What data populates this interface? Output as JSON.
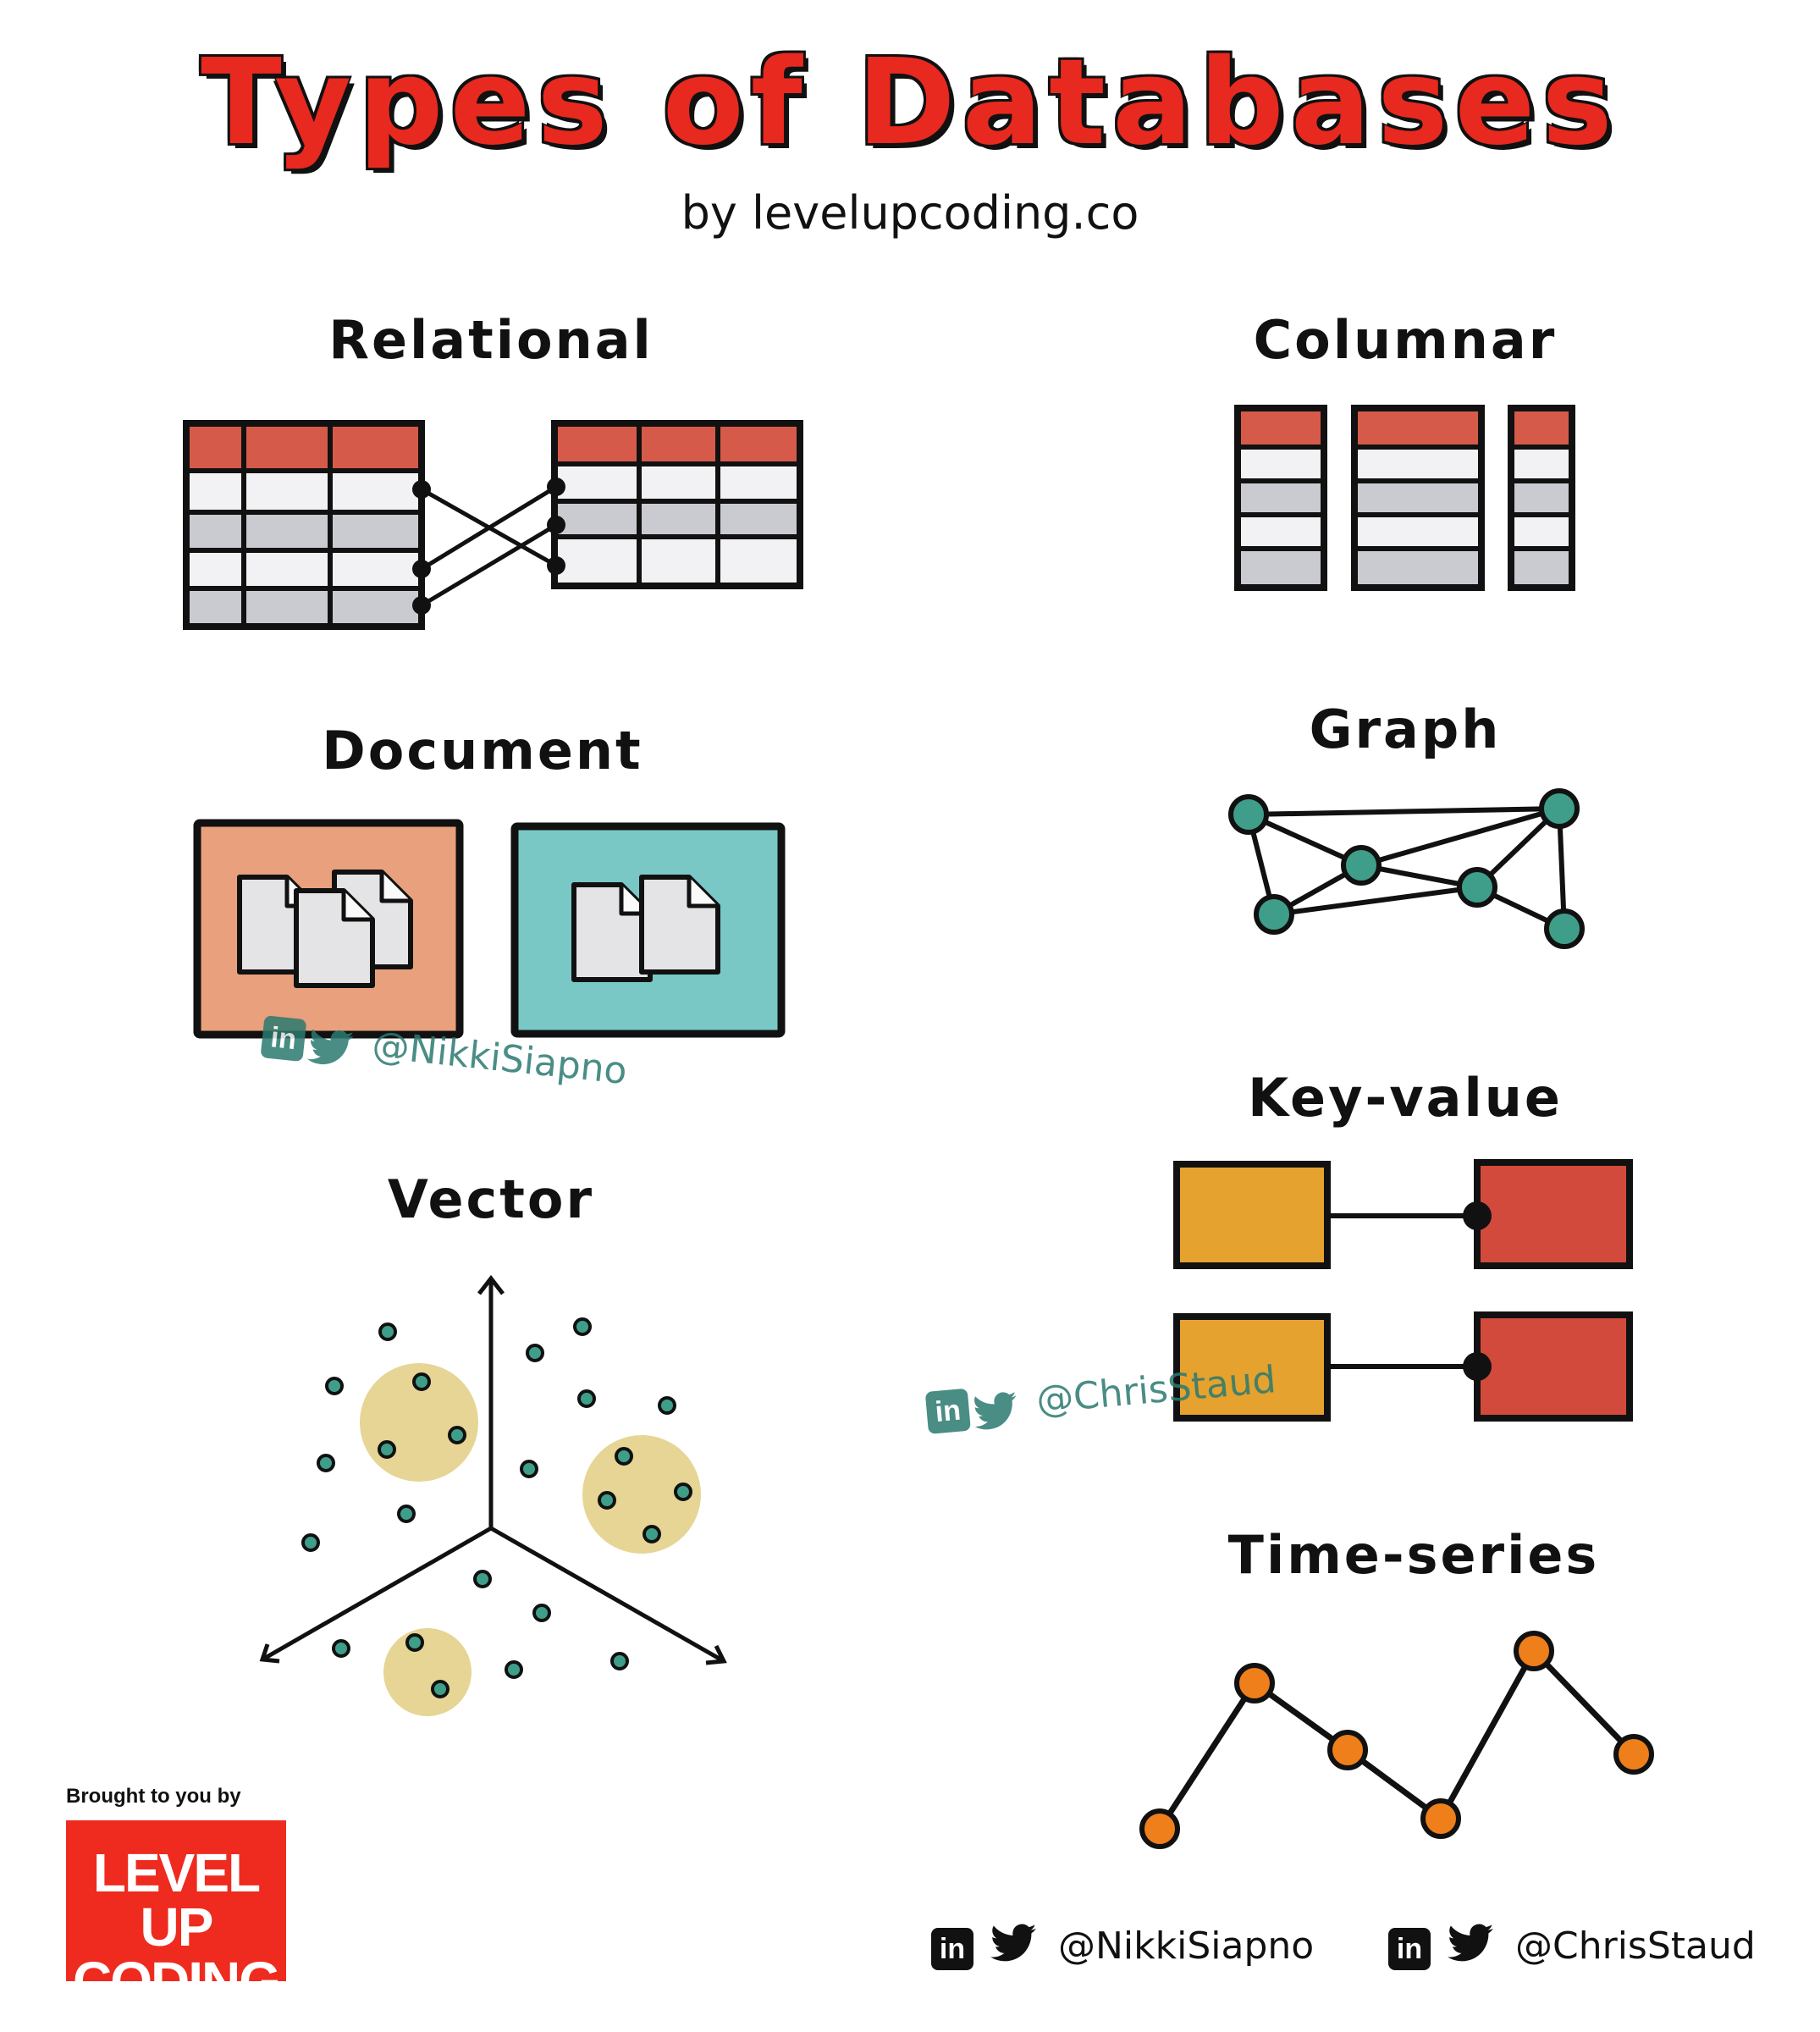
{
  "title": "Types of Databases",
  "subtitle": "by levelupcoding.co",
  "sections": {
    "relational": "Relational",
    "columnar": "Columnar",
    "document": "Document",
    "graph": "Graph",
    "key_value": "Key-value",
    "vector": "Vector",
    "time_series": "Time-series"
  },
  "watermarks": {
    "nikki": "@NikkiSiapno",
    "chris": "@ChrisStaud"
  },
  "branding": {
    "caption": "Brought to you by",
    "logo_line1": "LEVEL UP",
    "logo_line2": "CODING"
  },
  "footer": {
    "handle1": "@NikkiSiapno",
    "handle2": "@ChrisStaud",
    "linkedin_glyph": "in"
  },
  "colors": {
    "title_red": "#e8291f",
    "table_header": "#d65a4a",
    "doc_orange": "#e8a17c",
    "doc_teal": "#79c8c6",
    "node_teal": "#3e9e89",
    "kv_orange": "#e5a22e",
    "kv_red": "#d24a3b",
    "ts_orange": "#ee7f1b",
    "cluster": "#e6d594"
  },
  "icons": [
    "linkedin-icon",
    "twitter-icon",
    "document-icon"
  ]
}
